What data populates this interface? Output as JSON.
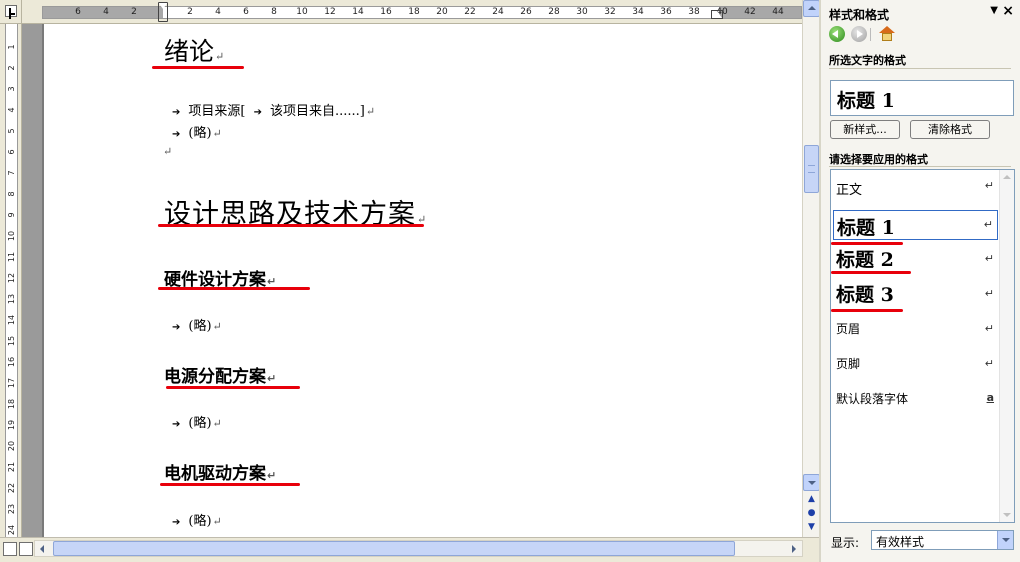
{
  "ruler": {
    "h_ticks": [
      "6",
      "4",
      "2",
      "2",
      "4",
      "6",
      "8",
      "10",
      "12",
      "14",
      "16",
      "18",
      "20",
      "22",
      "24",
      "26",
      "28",
      "30",
      "32",
      "34",
      "36",
      "38",
      "40",
      "42",
      "44"
    ],
    "v_ticks": [
      "1",
      "2",
      "3",
      "4",
      "5",
      "6",
      "7",
      "8",
      "9",
      "10",
      "11",
      "12",
      "13",
      "14",
      "15",
      "16",
      "17",
      "18",
      "19",
      "20",
      "21",
      "22",
      "23",
      "24"
    ]
  },
  "document": {
    "heading_intro": "绪论",
    "bullet_source": "项目来源[",
    "bullet_source_rest": "该项目来自......]",
    "bullet_omit": "(略)",
    "empty_mark": "↵",
    "heading_design": "设计思路及技术方案",
    "h2_hardware": "硬件设计方案",
    "h2_power": "电源分配方案",
    "h2_motor": "电机驱动方案",
    "para_mark": "↵"
  },
  "pane": {
    "title": "样式和格式",
    "selected_format_label": "所选文字的格式",
    "current_style": "标题 1",
    "new_style_button": "新样式...",
    "clear_format_button": "清除格式",
    "apply_label": "请选择要应用的格式",
    "styles": [
      {
        "name": "正文",
        "mark": "↵"
      },
      {
        "name": "标题 1",
        "mark": "↵"
      },
      {
        "name": "标题 2",
        "mark": "↵"
      },
      {
        "name": "标题 3",
        "mark": "↵"
      },
      {
        "name": "页眉",
        "mark": "↵"
      },
      {
        "name": "页脚",
        "mark": "↵"
      },
      {
        "name": "默认段落字体",
        "mark": "a"
      }
    ],
    "show_label": "显示:",
    "show_value": "有效样式"
  },
  "colors": {
    "underline_red": "#e8000b",
    "selection_border": "#316ac5"
  }
}
